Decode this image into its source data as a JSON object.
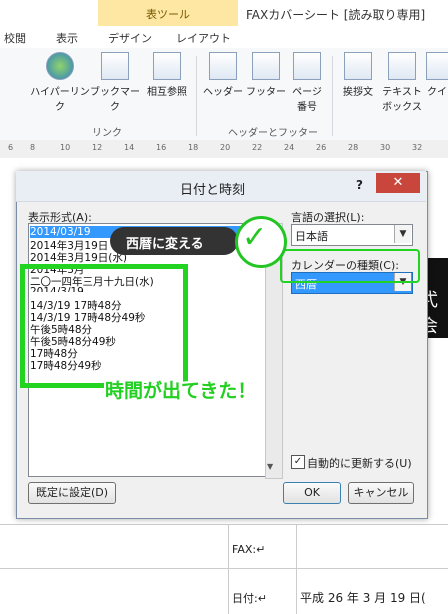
{
  "window": {
    "title": "FAXカバーシート [読み取り専用]",
    "context_tab_group": "表ツール"
  },
  "tabs": [
    "校閲",
    "表示",
    "デザイン",
    "レイアウト"
  ],
  "ribbon": {
    "buttons": [
      "ハイパーリンク",
      "ブックマーク",
      "相互参照",
      "ヘッダー",
      "フッター",
      "ページ\n番号",
      "挨拶文",
      "テキスト\nボックス",
      "クイ"
    ],
    "groups": [
      "リンク",
      "ヘッダーとフッター"
    ]
  },
  "ruler": [
    "6",
    "8",
    "10",
    "12",
    "14",
    "16",
    "18",
    "20",
    "22",
    "24",
    "26",
    "28",
    "30",
    "32"
  ],
  "dialog": {
    "title": "日付と時刻",
    "help": "?",
    "close": "✕",
    "format_label": "表示形式(A):",
    "formats": [
      "2014/03/19",
      "2014年3月19日",
      "2014年3月19日(水)",
      "2014年3月",
      "二〇一四年三月十九日(水)",
      "2014/3/19",
      "14/3/19 17時48分",
      "14/3/19 17時48分49秒",
      "午後5時48分",
      "午後5時48分49秒",
      "17時48分",
      "17時48分49秒"
    ],
    "language_label": "言語の選択(L):",
    "language_value": "日本語",
    "calendar_label": "カレンダーの種類(C):",
    "calendar_value": "西暦",
    "auto_update_label": "自動的に更新する(U)",
    "auto_update_checked": true,
    "default_button": "既定に設定(D)",
    "ok_button": "OK",
    "cancel_button": "キャンセル"
  },
  "annotations": {
    "callout": "西暦に変える",
    "result_note": "時間が出てきた！"
  },
  "document": {
    "fax_label": "FAX:↵",
    "date_label": "日付:↵",
    "date_value": "平成 26 年 3 月 19 日(",
    "black_block_text": "弌会"
  },
  "colors": {
    "annotation_green": "#22d322",
    "selection_blue": "#3399ff",
    "close_red": "#c9463d"
  }
}
